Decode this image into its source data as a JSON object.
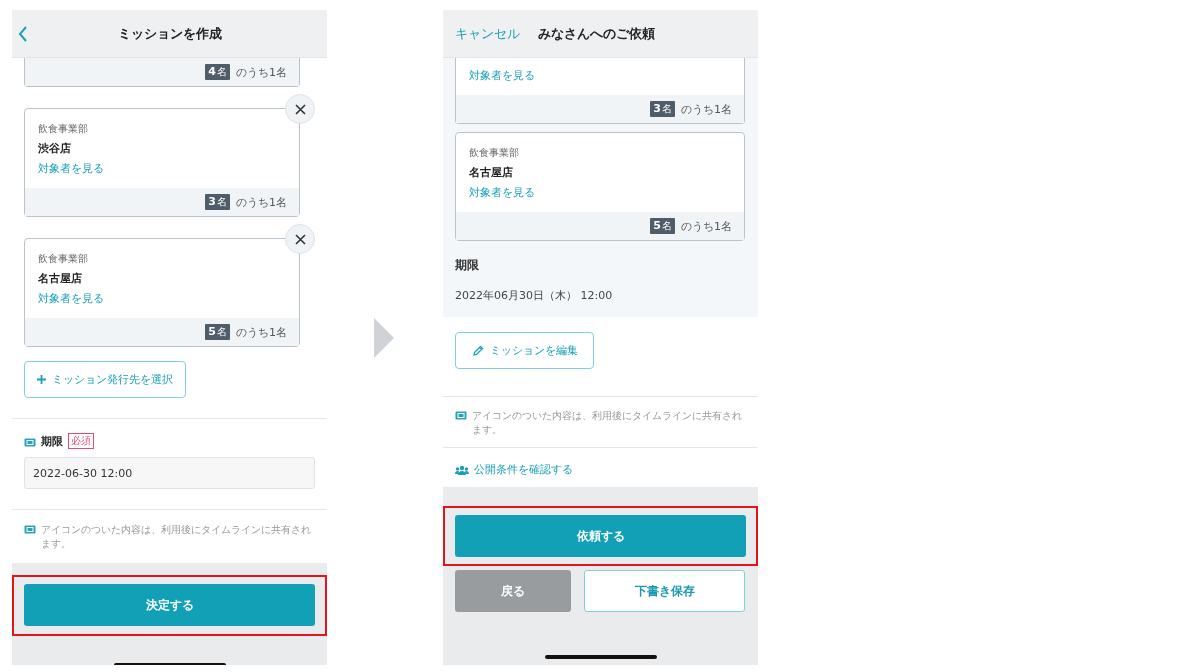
{
  "screens": [
    {
      "kind": "create",
      "header": {
        "title": "ミッションを作成"
      },
      "cards": [
        {
          "partial": true,
          "removable": false,
          "count": "4",
          "count_unit": "名",
          "count_suffix": "のうち1名"
        },
        {
          "partial": false,
          "removable": true,
          "department": "飲食事業部",
          "store": "渋谷店",
          "link": "対象者を見る",
          "count": "3",
          "count_unit": "名",
          "count_suffix": "のうち1名"
        },
        {
          "partial": false,
          "removable": true,
          "department": "飲食事業部",
          "store": "名古屋店",
          "link": "対象者を見る",
          "count": "5",
          "count_unit": "名",
          "count_suffix": "のうち1名"
        }
      ],
      "add_button": "ミッション発行先を選択",
      "deadline": {
        "label": "期限",
        "required_badge": "必須",
        "value": "2022-06-30 12:00"
      },
      "note": "アイコンのついた内容は、利用後にタイムラインに共有されます。",
      "primary_button": {
        "label": "決定する",
        "highlighted": true
      }
    },
    {
      "kind": "confirm",
      "header": {
        "cancel": "キャンセル",
        "title": "みなさんへのご依頼"
      },
      "cards": [
        {
          "partial": true,
          "removable": false,
          "link": "対象者を見る",
          "count": "3",
          "count_unit": "名",
          "count_suffix": "のうち1名"
        },
        {
          "partial": false,
          "removable": false,
          "department": "飲食事業部",
          "store": "名古屋店",
          "link": "対象者を見る",
          "count": "5",
          "count_unit": "名",
          "count_suffix": "のうち1名"
        }
      ],
      "deadline": {
        "label": "期限",
        "value": "2022年06月30日（木） 12:00"
      },
      "edit_button": "ミッションを編集",
      "note": "アイコンのついた内容は、利用後にタイムラインに共有されます。",
      "link": "公開条件を確認する",
      "primary_button": {
        "label": "依頼する",
        "highlighted": true
      },
      "secondary_buttons": [
        {
          "kind": "back",
          "label": "戻る"
        },
        {
          "kind": "outline",
          "label": "下書き保存"
        }
      ]
    }
  ]
}
